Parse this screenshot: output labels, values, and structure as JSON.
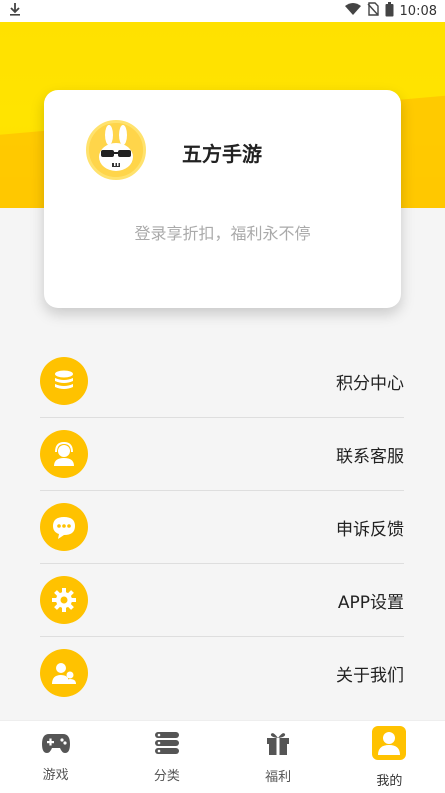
{
  "status": {
    "time": "10:08",
    "icons": [
      "download-icon",
      "wifi-icon",
      "no-sim-icon",
      "battery-icon"
    ]
  },
  "profile": {
    "brand": "五方手游",
    "subtitle": "登录享折扣，福利永不停"
  },
  "menu": {
    "items": [
      {
        "label": "积分中心",
        "icon": "coins-icon"
      },
      {
        "label": "联系客服",
        "icon": "support-agent-icon"
      },
      {
        "label": "申诉反馈",
        "icon": "chat-bubble-icon"
      },
      {
        "label": "APP设置",
        "icon": "gear-icon"
      },
      {
        "label": "关于我们",
        "icon": "people-icon"
      }
    ]
  },
  "tabs": [
    {
      "label": "游戏",
      "icon": "gamepad-icon"
    },
    {
      "label": "分类",
      "icon": "list-icon"
    },
    {
      "label": "福利",
      "icon": "gift-icon"
    },
    {
      "label": "我的",
      "icon": "user-icon",
      "active": true
    }
  ],
  "colors": {
    "accent": "#ffc200",
    "hero": "#ffe100"
  }
}
